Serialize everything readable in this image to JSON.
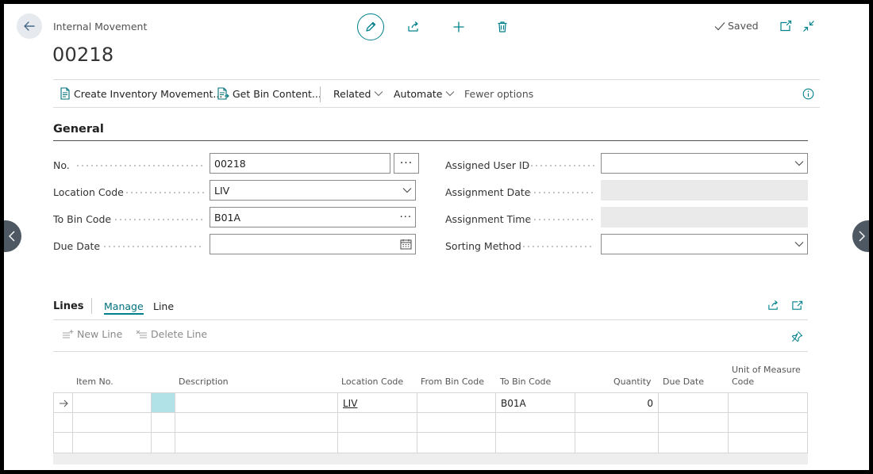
{
  "header": {
    "caption": "Internal Movement",
    "number": "00218",
    "saved_label": "Saved"
  },
  "actions": {
    "create_inventory_movement": "Create Inventory Movement...",
    "get_bin_content": "Get Bin Content...",
    "related": "Related",
    "automate": "Automate",
    "fewer_options": "Fewer options"
  },
  "general": {
    "title": "General",
    "no_label": "No.",
    "no_value": "00218",
    "location_code_label": "Location Code",
    "location_code_value": "LIV",
    "to_bin_code_label": "To Bin Code",
    "to_bin_code_value": "B01A",
    "due_date_label": "Due Date",
    "due_date_value": "",
    "assigned_user_id_label": "Assigned User ID",
    "assigned_user_id_value": "",
    "assignment_date_label": "Assignment Date",
    "assignment_date_value": "",
    "assignment_time_label": "Assignment Time",
    "assignment_time_value": "",
    "sorting_method_label": "Sorting Method",
    "sorting_method_value": ""
  },
  "lines": {
    "title": "Lines",
    "tabs": [
      "Manage",
      "Line"
    ],
    "new_line": "New Line",
    "delete_line": "Delete Line",
    "columns": {
      "item_no": "Item No.",
      "description": "Description",
      "location_code": "Location Code",
      "from_bin_code": "From Bin Code",
      "to_bin_code": "To Bin Code",
      "quantity": "Quantity",
      "due_date": "Due Date",
      "unit_of_measure_line1": "Unit of Measure",
      "unit_of_measure_line2": "Code"
    },
    "rows": [
      {
        "item_no": "",
        "description": "",
        "location_code": "LIV",
        "from_bin_code": "",
        "to_bin_code": "B01A",
        "quantity": "0",
        "due_date": "",
        "unit_of_measure": ""
      },
      {
        "item_no": "",
        "description": "",
        "location_code": "",
        "from_bin_code": "",
        "to_bin_code": "",
        "quantity": "",
        "due_date": "",
        "unit_of_measure": ""
      },
      {
        "item_no": "",
        "description": "",
        "location_code": "",
        "from_bin_code": "",
        "to_bin_code": "",
        "quantity": "",
        "due_date": "",
        "unit_of_measure": ""
      }
    ]
  },
  "colors": {
    "accent": "#00808b",
    "accent_text": "#00707a",
    "selected_cell": "#b0e2e8",
    "nav_arrow": "#4d5863"
  },
  "icons": {
    "back": "arrow-left-icon",
    "edit": "pencil-icon",
    "share": "share-icon",
    "new": "plus-icon",
    "delete": "trash-icon",
    "saved": "checkmark-icon",
    "open_new_window": "open-in-new-window-icon",
    "collapse": "collapse-icon",
    "info": "info-icon"
  }
}
